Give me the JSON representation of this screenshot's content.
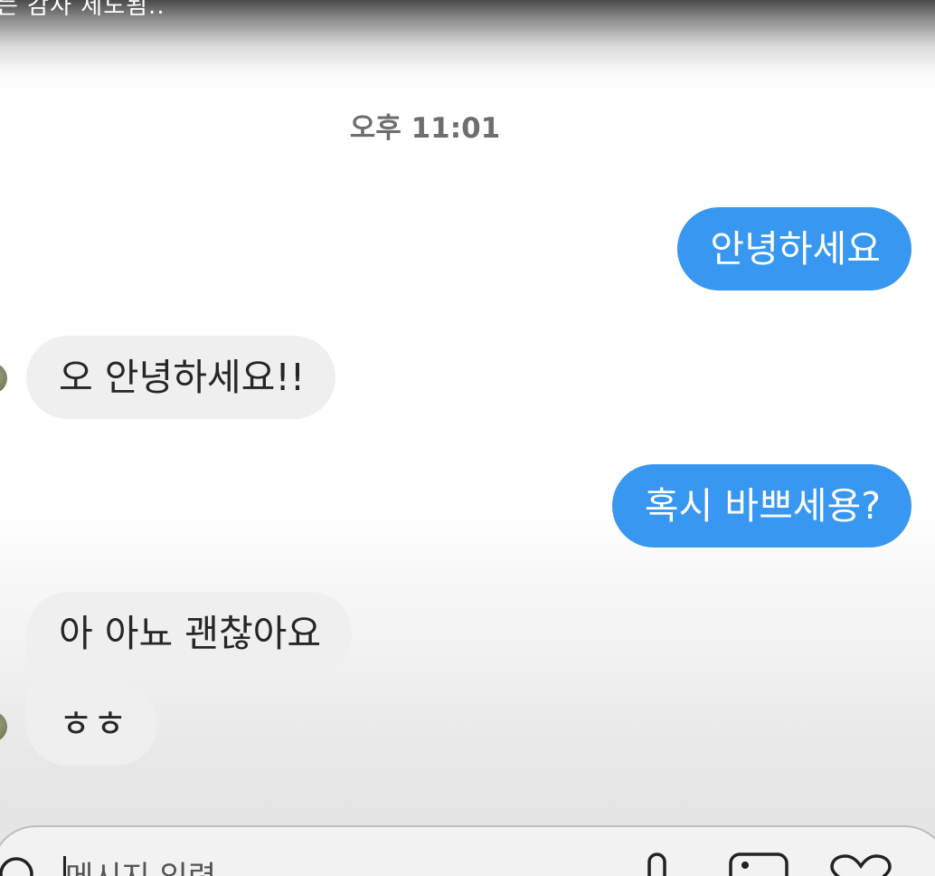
{
  "top_caption": "는 감사 제도됨..",
  "thread": {
    "timestamp": "오후 11:01",
    "messages": [
      {
        "direction": "outgoing",
        "text": "안녕하세요"
      },
      {
        "direction": "incoming",
        "text": "오 안녕하세요!!"
      },
      {
        "direction": "outgoing",
        "text": "혹시 바쁘세용?"
      },
      {
        "direction": "incoming",
        "text": "아 아뇨 괜찮아요"
      },
      {
        "direction": "incoming",
        "text": "ㅎㅎ"
      }
    ]
  },
  "composer": {
    "placeholder": "메시지 입력...",
    "icons": [
      "emoji-icon",
      "microphone-icon",
      "image-icon",
      "heart-icon"
    ]
  },
  "colors": {
    "outgoing_bubble": "#3897f0",
    "incoming_bubble": "#efefef",
    "timestamp_text": "#6e6e6e"
  }
}
